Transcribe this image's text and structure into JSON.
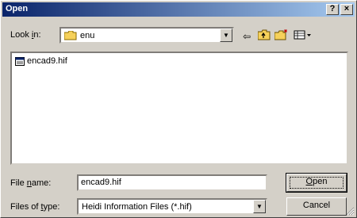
{
  "window": {
    "title": "Open"
  },
  "titlebar": {
    "help_label": "?",
    "close_label": "×"
  },
  "look_in": {
    "label_pre": "Look ",
    "label_key": "i",
    "label_post": "n:",
    "value": "enu"
  },
  "toolbar": {
    "back_glyph": "⇦",
    "up_glyph": "⬆",
    "new_folder_glyph": "✱",
    "views_glyph": "▦▾"
  },
  "files": [
    {
      "name": "encad9.hif",
      "icon": "document-icon"
    }
  ],
  "file_name": {
    "label_pre": "File ",
    "label_key": "n",
    "label_post": "ame:",
    "value": "encad9.hif"
  },
  "file_type": {
    "label_pre": "Files of ",
    "label_key": "t",
    "label_post": "ype:",
    "value": "Heidi Information Files (*.hif)"
  },
  "buttons": {
    "open_key": "O",
    "open_rest": "pen",
    "cancel": "Cancel"
  },
  "colors": {
    "title_start": "#0a246a",
    "title_end": "#a6caf0",
    "face": "#d4d0c8",
    "folder": "#f6d15a"
  }
}
